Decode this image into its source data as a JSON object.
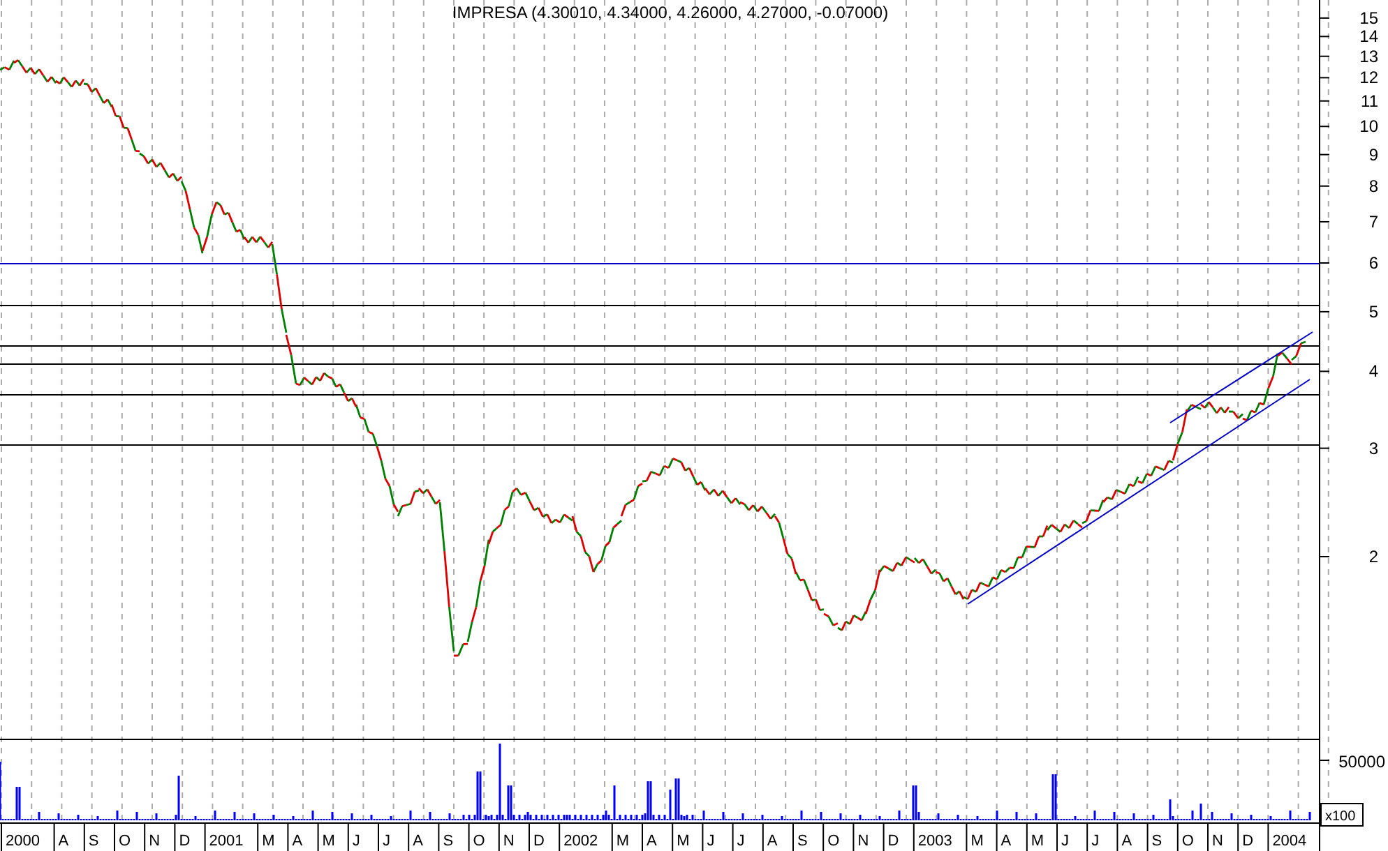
{
  "title": "IMPRESA (4.30010, 4.34000, 4.26000, 4.27000, -0.07000)",
  "price_axis": [
    "15",
    "14",
    "13",
    "12",
    "11",
    "10",
    "9",
    "8",
    "7",
    "6",
    "5",
    "4",
    "3",
    "2"
  ],
  "volume_axis": {
    "tick": "50000",
    "unit": "x100"
  },
  "time_axis": [
    "2000",
    "A",
    "S",
    "O",
    "N",
    "D",
    "2001",
    "M",
    "A",
    "M",
    "J",
    "J",
    "A",
    "S",
    "O",
    "N",
    "D",
    "2002",
    "M",
    "A",
    "M",
    "J",
    "J",
    "A",
    "S",
    "O",
    "N",
    "D",
    "2003",
    "M",
    "A",
    "M",
    "J",
    "J",
    "A",
    "S",
    "O",
    "N",
    "D",
    "2004"
  ]
}
